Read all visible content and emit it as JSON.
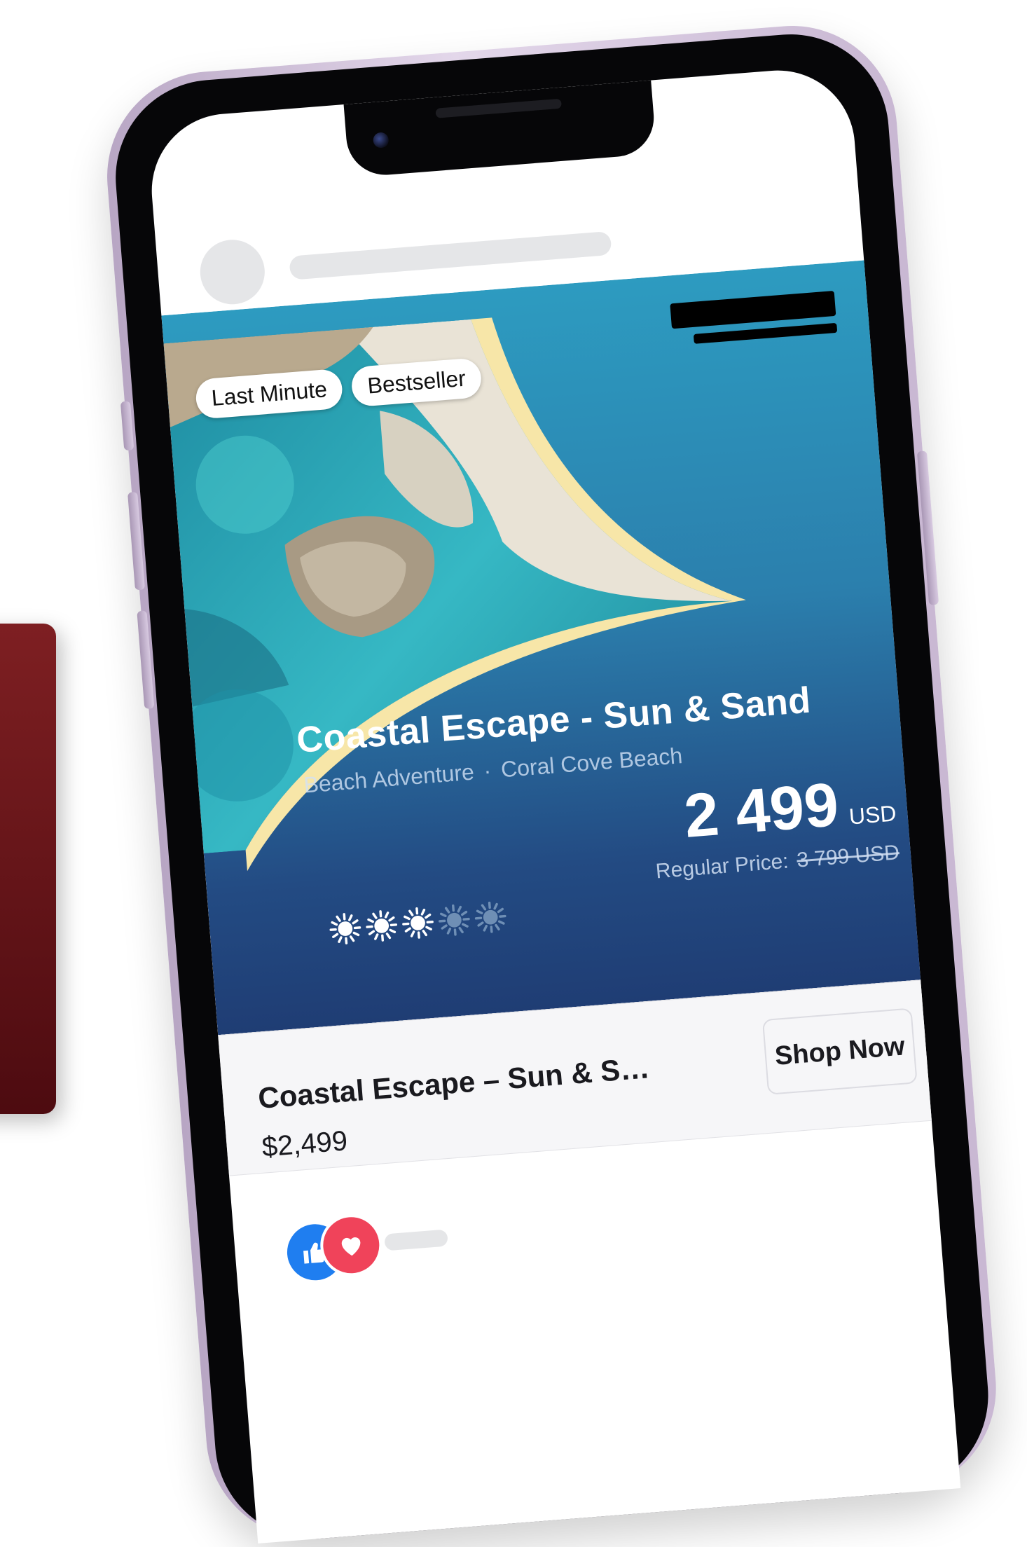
{
  "ad": {
    "badges": [
      "Last Minute",
      "Bestseller"
    ],
    "title": "Coastal Escape - Sun & Sand",
    "category": "Beach Adventure",
    "location": "Coral Cove Beach",
    "price": "2 499",
    "currency": "USD",
    "regular_price_label": "Regular Price:",
    "regular_price": "3 799 USD",
    "rating": {
      "value": 3,
      "max": 5,
      "icon": "sun-icon"
    },
    "colors": {
      "accent_curve": "#f7e6a8",
      "top_blue": "#2d9bc0",
      "bottom_navy": "#1f3d74"
    }
  },
  "cta": {
    "title": "Coastal Escape – Sun & S…",
    "price": "$2,499",
    "button_label": "Shop Now"
  },
  "reactions": {
    "icons": [
      "thumbs-up-icon",
      "heart-icon"
    ]
  }
}
